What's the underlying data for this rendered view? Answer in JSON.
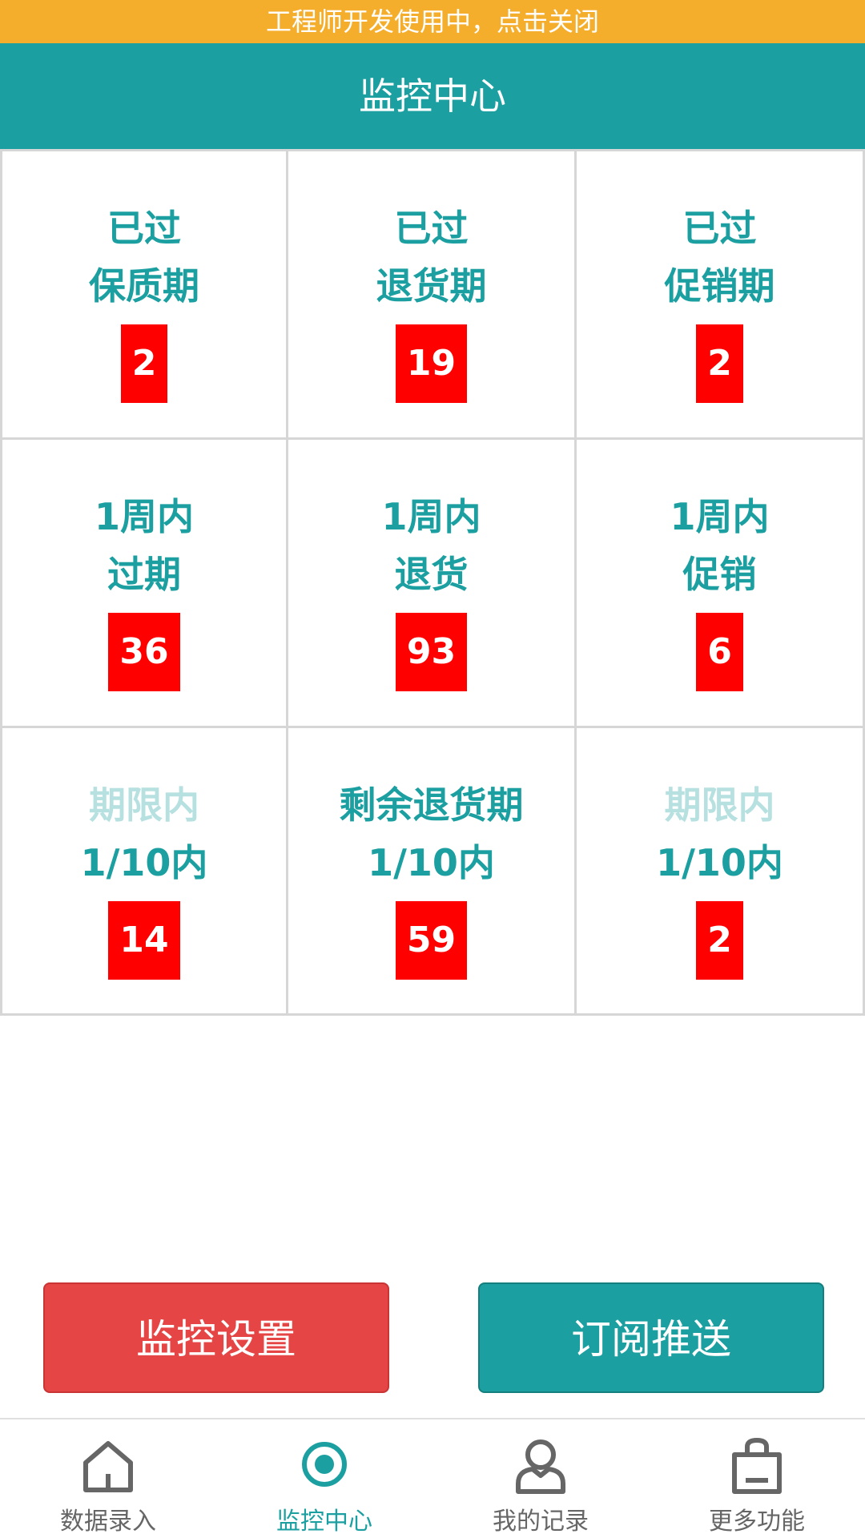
{
  "banner": {
    "text": "工程师开发使用中，点击关闭"
  },
  "header": {
    "title": "监控中心"
  },
  "cells": [
    {
      "line1": "已过",
      "line2": "保质期",
      "count": "2"
    },
    {
      "line1": "已过",
      "line2": "退货期",
      "count": "19"
    },
    {
      "line1": "已过",
      "line2": "促销期",
      "count": "2"
    },
    {
      "line1": "1周内",
      "line2": "过期",
      "count": "36"
    },
    {
      "line1": "1周内",
      "line2": "退货",
      "count": "93"
    },
    {
      "line1": "1周内",
      "line2": "促销",
      "count": "6"
    },
    {
      "line1": "期限内",
      "line2": "1/10内",
      "count": "14"
    },
    {
      "line1": "剩余退货期",
      "line2": "1/10内",
      "count": "59"
    },
    {
      "line1": "期限内",
      "line2": "1/10内",
      "count": "2"
    }
  ],
  "buttons": {
    "settings": "监控设置",
    "subscribe": "订阅推送"
  },
  "tabs": [
    {
      "label": "数据录入",
      "icon": "home-icon"
    },
    {
      "label": "监控中心",
      "icon": "target-icon"
    },
    {
      "label": "我的记录",
      "icon": "user-icon"
    },
    {
      "label": "更多功能",
      "icon": "bag-icon"
    }
  ],
  "colors": {
    "banner": "#f5ad2c",
    "primary": "#1c9fa0",
    "count_bg": "#ff0000",
    "settings_button": "#e64545"
  }
}
